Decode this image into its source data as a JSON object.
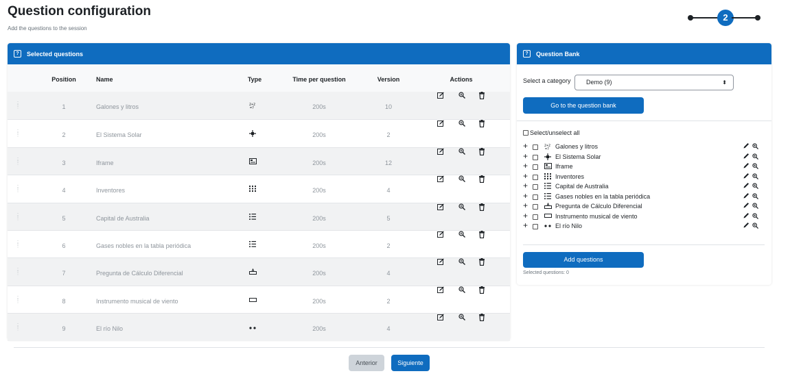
{
  "header": {
    "title": "Question configuration",
    "subtitle": "Add the questions to the session",
    "stepper_current": "2"
  },
  "selected": {
    "panel_title": "Selected questions",
    "columns": [
      "Position",
      "Name",
      "Type",
      "Time per question",
      "Version",
      "Actions"
    ],
    "rows": [
      {
        "position": "1",
        "name": "Galones y litros",
        "type_icon": "calculated-icon",
        "time": "200s",
        "version": "10"
      },
      {
        "position": "2",
        "name": "El Sistema Solar",
        "type_icon": "drag-drop-icon",
        "time": "200s",
        "version": "2"
      },
      {
        "position": "3",
        "name": "Iframe",
        "type_icon": "iframe-icon",
        "time": "200s",
        "version": "12"
      },
      {
        "position": "4",
        "name": "Inventores",
        "type_icon": "matching-icon",
        "time": "200s",
        "version": "4"
      },
      {
        "position": "5",
        "name": "Capital de Australia",
        "type_icon": "multichoice-icon",
        "time": "200s",
        "version": "5"
      },
      {
        "position": "6",
        "name": "Gases nobles en la tabla periódica",
        "type_icon": "multichoice-icon",
        "time": "200s",
        "version": "2"
      },
      {
        "position": "7",
        "name": "Pregunta de Cálculo Diferencial",
        "type_icon": "numerical-icon",
        "time": "200s",
        "version": "4"
      },
      {
        "position": "8",
        "name": "Instrumento musical de viento",
        "type_icon": "shortanswer-icon",
        "time": "200s",
        "version": "2"
      },
      {
        "position": "9",
        "name": "El río Nilo",
        "type_icon": "truefalse-icon",
        "time": "200s",
        "version": "4"
      }
    ]
  },
  "bank": {
    "panel_title": "Question Bank",
    "category_label": "Select a category",
    "category_value": "Demo (9)",
    "goto_button": "Go to the question bank",
    "select_all": "Select/unselect all",
    "items": [
      {
        "name": "Galones y litros",
        "type_icon": "calculated-icon"
      },
      {
        "name": "El Sistema Solar",
        "type_icon": "drag-drop-icon"
      },
      {
        "name": "Iframe",
        "type_icon": "iframe-icon"
      },
      {
        "name": "Inventores",
        "type_icon": "matching-icon"
      },
      {
        "name": "Capital de Australia",
        "type_icon": "multichoice-icon"
      },
      {
        "name": "Gases nobles en la tabla periódica",
        "type_icon": "multichoice-icon"
      },
      {
        "name": "Pregunta de Cálculo Diferencial",
        "type_icon": "numerical-icon"
      },
      {
        "name": "Instrumento musical de viento",
        "type_icon": "shortanswer-icon"
      },
      {
        "name": "El río Nilo",
        "type_icon": "truefalse-icon"
      }
    ],
    "add_button": "Add questions",
    "selected_count": "Selected questions: 0"
  },
  "footer": {
    "prev_label": "Anterior",
    "next_label": "Siguiente"
  },
  "colors": {
    "primary": "#0f6cbf",
    "row_stripe": "#f1f2f3",
    "secondary_button": "#ced4da"
  }
}
